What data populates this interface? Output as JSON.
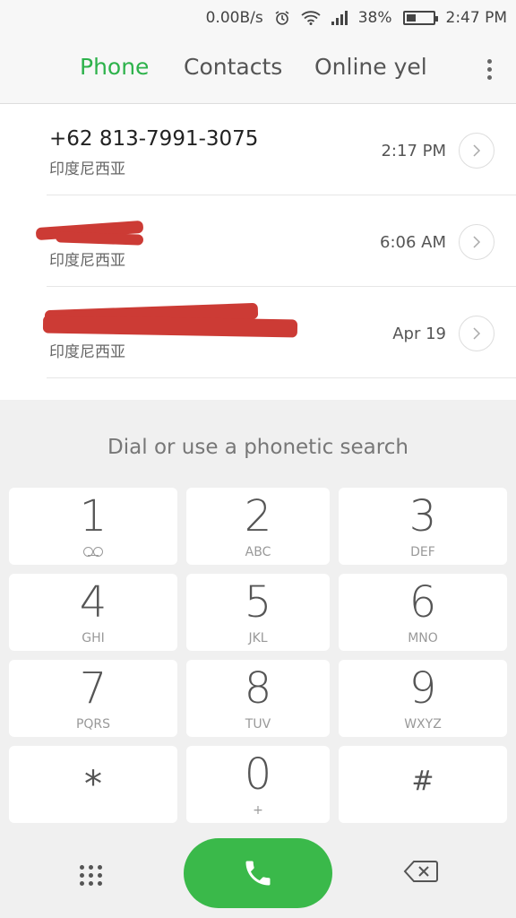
{
  "status": {
    "speed": "0.00B/s",
    "battery": "38%",
    "battery_level": 0.38,
    "time": "2:47 PM"
  },
  "tabs": [
    {
      "label": "Phone",
      "active": true
    },
    {
      "label": "Contacts",
      "active": false
    },
    {
      "label": "Online yel",
      "active": false
    }
  ],
  "calls": [
    {
      "number": "+62 813-7991-3075",
      "location": "印度尼西亚",
      "time": "2:17 PM"
    },
    {
      "number": "",
      "location": "印度尼西亚",
      "time": "6:06 AM"
    },
    {
      "number": "",
      "location": "印度尼西亚",
      "time": "Apr 19"
    }
  ],
  "dialpad": {
    "hint": "Dial or use a phonetic search",
    "keys": [
      {
        "digit": "1",
        "letters": ""
      },
      {
        "digit": "2",
        "letters": "ABC"
      },
      {
        "digit": "3",
        "letters": "DEF"
      },
      {
        "digit": "4",
        "letters": "GHI"
      },
      {
        "digit": "5",
        "letters": "JKL"
      },
      {
        "digit": "6",
        "letters": "MNO"
      },
      {
        "digit": "7",
        "letters": "PQRS"
      },
      {
        "digit": "8",
        "letters": "TUV"
      },
      {
        "digit": "9",
        "letters": "WXYZ"
      },
      {
        "digit": "*",
        "letters": ""
      },
      {
        "digit": "0",
        "letters": "+"
      },
      {
        "digit": "#",
        "letters": ""
      }
    ]
  },
  "colors": {
    "accent": "#2db24b",
    "call_button": "#3ab94a",
    "redaction": "#cc3b35"
  }
}
